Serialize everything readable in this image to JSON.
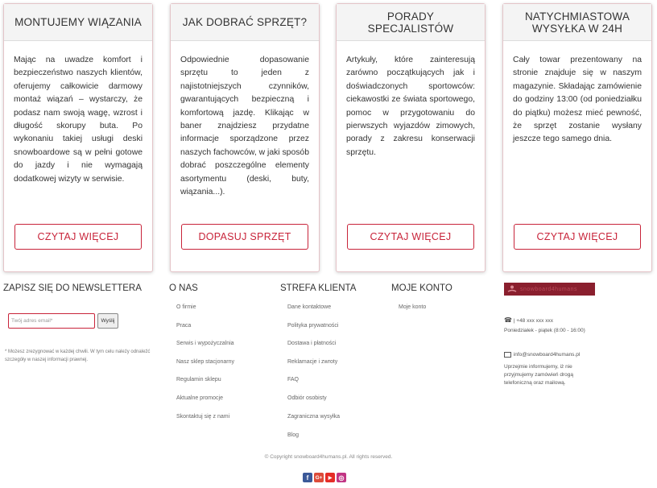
{
  "cards": [
    {
      "title": "MONTUJEMY WIĄZANIA",
      "body": "Mając na uwadze komfort i bezpieczeństwo naszych klientów, oferujemy całkowicie darmowy montaż wiązań – wystarczy, że podasz nam swoją wagę, wzrost i długość skorupy buta. Po wykonaniu takiej usługi deski snowboardowe są w pełni gotowe do jazdy i nie wymagają dodatkowej wizyty w serwisie.",
      "button": "CZYTAJ WIĘCEJ"
    },
    {
      "title": "JAK DOBRAĆ SPRZĘT?",
      "body": "Odpowiednie dopasowanie sprzętu to jeden z najistotniejszych czynników, gwarantujących bezpieczną i komfortową jazdę. Klikając w baner znajdziesz przydatne informacje sporządzone przez naszych fachowców, w jaki sposób dobrać poszczególne elementy asortymentu (deski, buty, wiązania...).",
      "button": "DOPASUJ SPRZĘT"
    },
    {
      "title": "PORADY SPECJALISTÓW",
      "body": "Artykuły, które zainteresują zarówno początkujących jak i doświadczonych sportowców: ciekawostki ze świata sportowego, pomoc w przygotowaniu do pierwszych wyjazdów zimowych, porady z zakresu konserwacji sprzętu.",
      "button": "CZYTAJ WIĘCEJ"
    },
    {
      "title": "NATYCHMIASTOWA WYSYŁKA W 24H",
      "body": "Cały towar prezentowany na stronie znajduje się w naszym magazynie. Składając zamówienie do godziny 13:00 (od poniedziałku do piątku) możesz mieć pewność, że sprzęt zostanie wysłany jeszcze tego samego dnia.",
      "button": "CZYTAJ WIĘCEJ"
    }
  ],
  "newsletter": {
    "title": "ZAPISZ SIĘ DO NEWSLETTERA",
    "placeholder": "Twój adres email*",
    "button": "Wyślij",
    "note": "* Możesz zrezygnować w każdej chwili. W tym celu należy odnaleźć szczegóły w naszej informacji prawnej."
  },
  "about": {
    "title": "O NAS",
    "links": [
      "O firmie",
      "Praca",
      "Serwis i wypożyczalnia",
      "Nasz sklep stacjonarny",
      "Regulamin sklepu",
      "Aktualne promocje",
      "Skontaktuj się z nami"
    ]
  },
  "client": {
    "title": "STREFA KLIENTA",
    "links": [
      "Dane kontaktowe",
      "Polityka prywatności",
      "Dostawa i płatności",
      "Reklamacje i zwroty",
      "FAQ",
      "Odbiór osobisty",
      "Zagraniczna wysyłka",
      "Blog"
    ]
  },
  "account": {
    "title": "MOJE KONTO",
    "links": [
      "Moje konto"
    ]
  },
  "contact": {
    "logo_text": "snowboard4humans",
    "phone": "| +48 xxx xxx xxx",
    "hours": "Poniedziałek - piątek (8:00 - 16:00)",
    "email": "info@snowboard4humans.pl",
    "email_note": "Uprzejmie informujemy, iż nie przyjmujemy zamówień drogą telefoniczną oraz mailową."
  },
  "copyright": "© Copyright snowboard4humans.pl. All rights reserved.",
  "socials": [
    {
      "icon": "facebook-icon",
      "glyph": "f",
      "color": "#3b5998"
    },
    {
      "icon": "google-plus-icon",
      "glyph": "G+",
      "color": "#dd4b39"
    },
    {
      "icon": "youtube-icon",
      "glyph": "▶",
      "color": "#e52d27"
    },
    {
      "icon": "instagram-icon",
      "glyph": "◎",
      "color": "#c13584"
    }
  ],
  "colors": {
    "accent": "#c8243a",
    "card_head_bg": "#f4f4f4",
    "logo_bg": "#8a1f2e"
  }
}
